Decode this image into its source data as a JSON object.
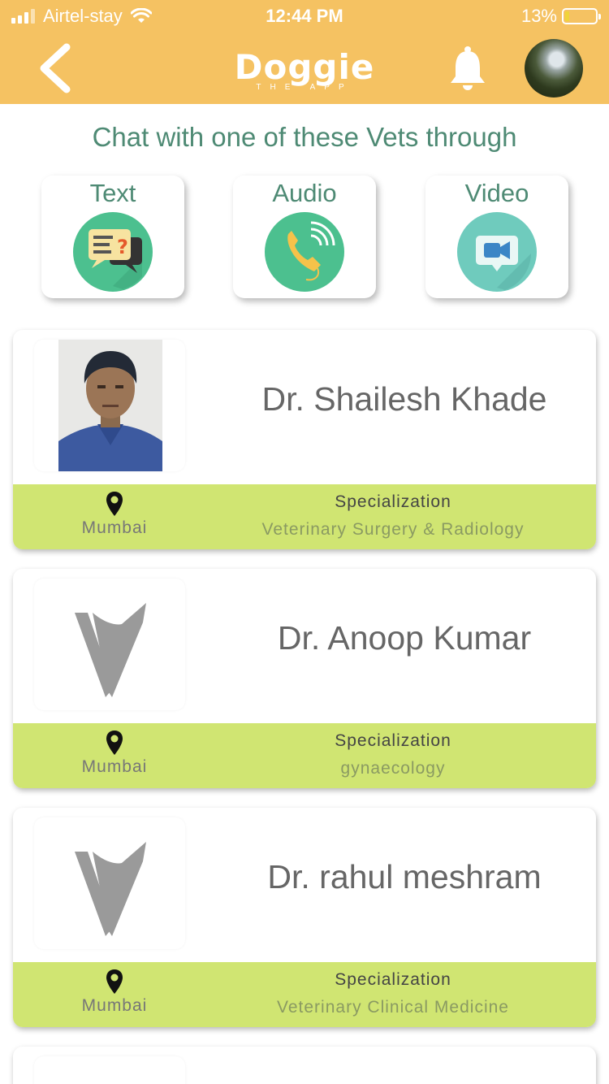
{
  "status_bar": {
    "carrier": "Airtel-stay",
    "time": "12:44 PM",
    "battery": "13%"
  },
  "header": {
    "logo_text": "Doggie",
    "logo_subtext": "THE APP",
    "icons": {
      "back": "chevron-left-icon",
      "notifications": "bell-icon",
      "avatar": "profile-avatar"
    }
  },
  "intro": "Chat with one of these Vets through",
  "modes": [
    {
      "label": "Text",
      "icon": "text-chat-icon",
      "color": "#4cc08f"
    },
    {
      "label": "Audio",
      "icon": "phone-call-icon",
      "color": "#4cc08f"
    },
    {
      "label": "Video",
      "icon": "video-call-icon",
      "color": "#6fcbbd"
    }
  ],
  "vets": [
    {
      "name": "Dr. Shailesh Khade",
      "city": "Mumbai",
      "specialization_label": "Specialization",
      "specialization": "Veterinary Surgery & Radiology",
      "photo": "portrait-photo"
    },
    {
      "name": "Dr. Anoop Kumar",
      "city": "Mumbai",
      "specialization_label": "Specialization",
      "specialization": "gynaecology",
      "photo": "vet-placeholder-logo"
    },
    {
      "name": "Dr. rahul meshram",
      "city": "Mumbai",
      "specialization_label": "Specialization",
      "specialization": "Veterinary Clinical Medicine",
      "photo": "vet-placeholder-logo"
    }
  ],
  "colors": {
    "header": "#f5c262",
    "accent_text": "#4e8a74",
    "strip": "#d0e572"
  }
}
